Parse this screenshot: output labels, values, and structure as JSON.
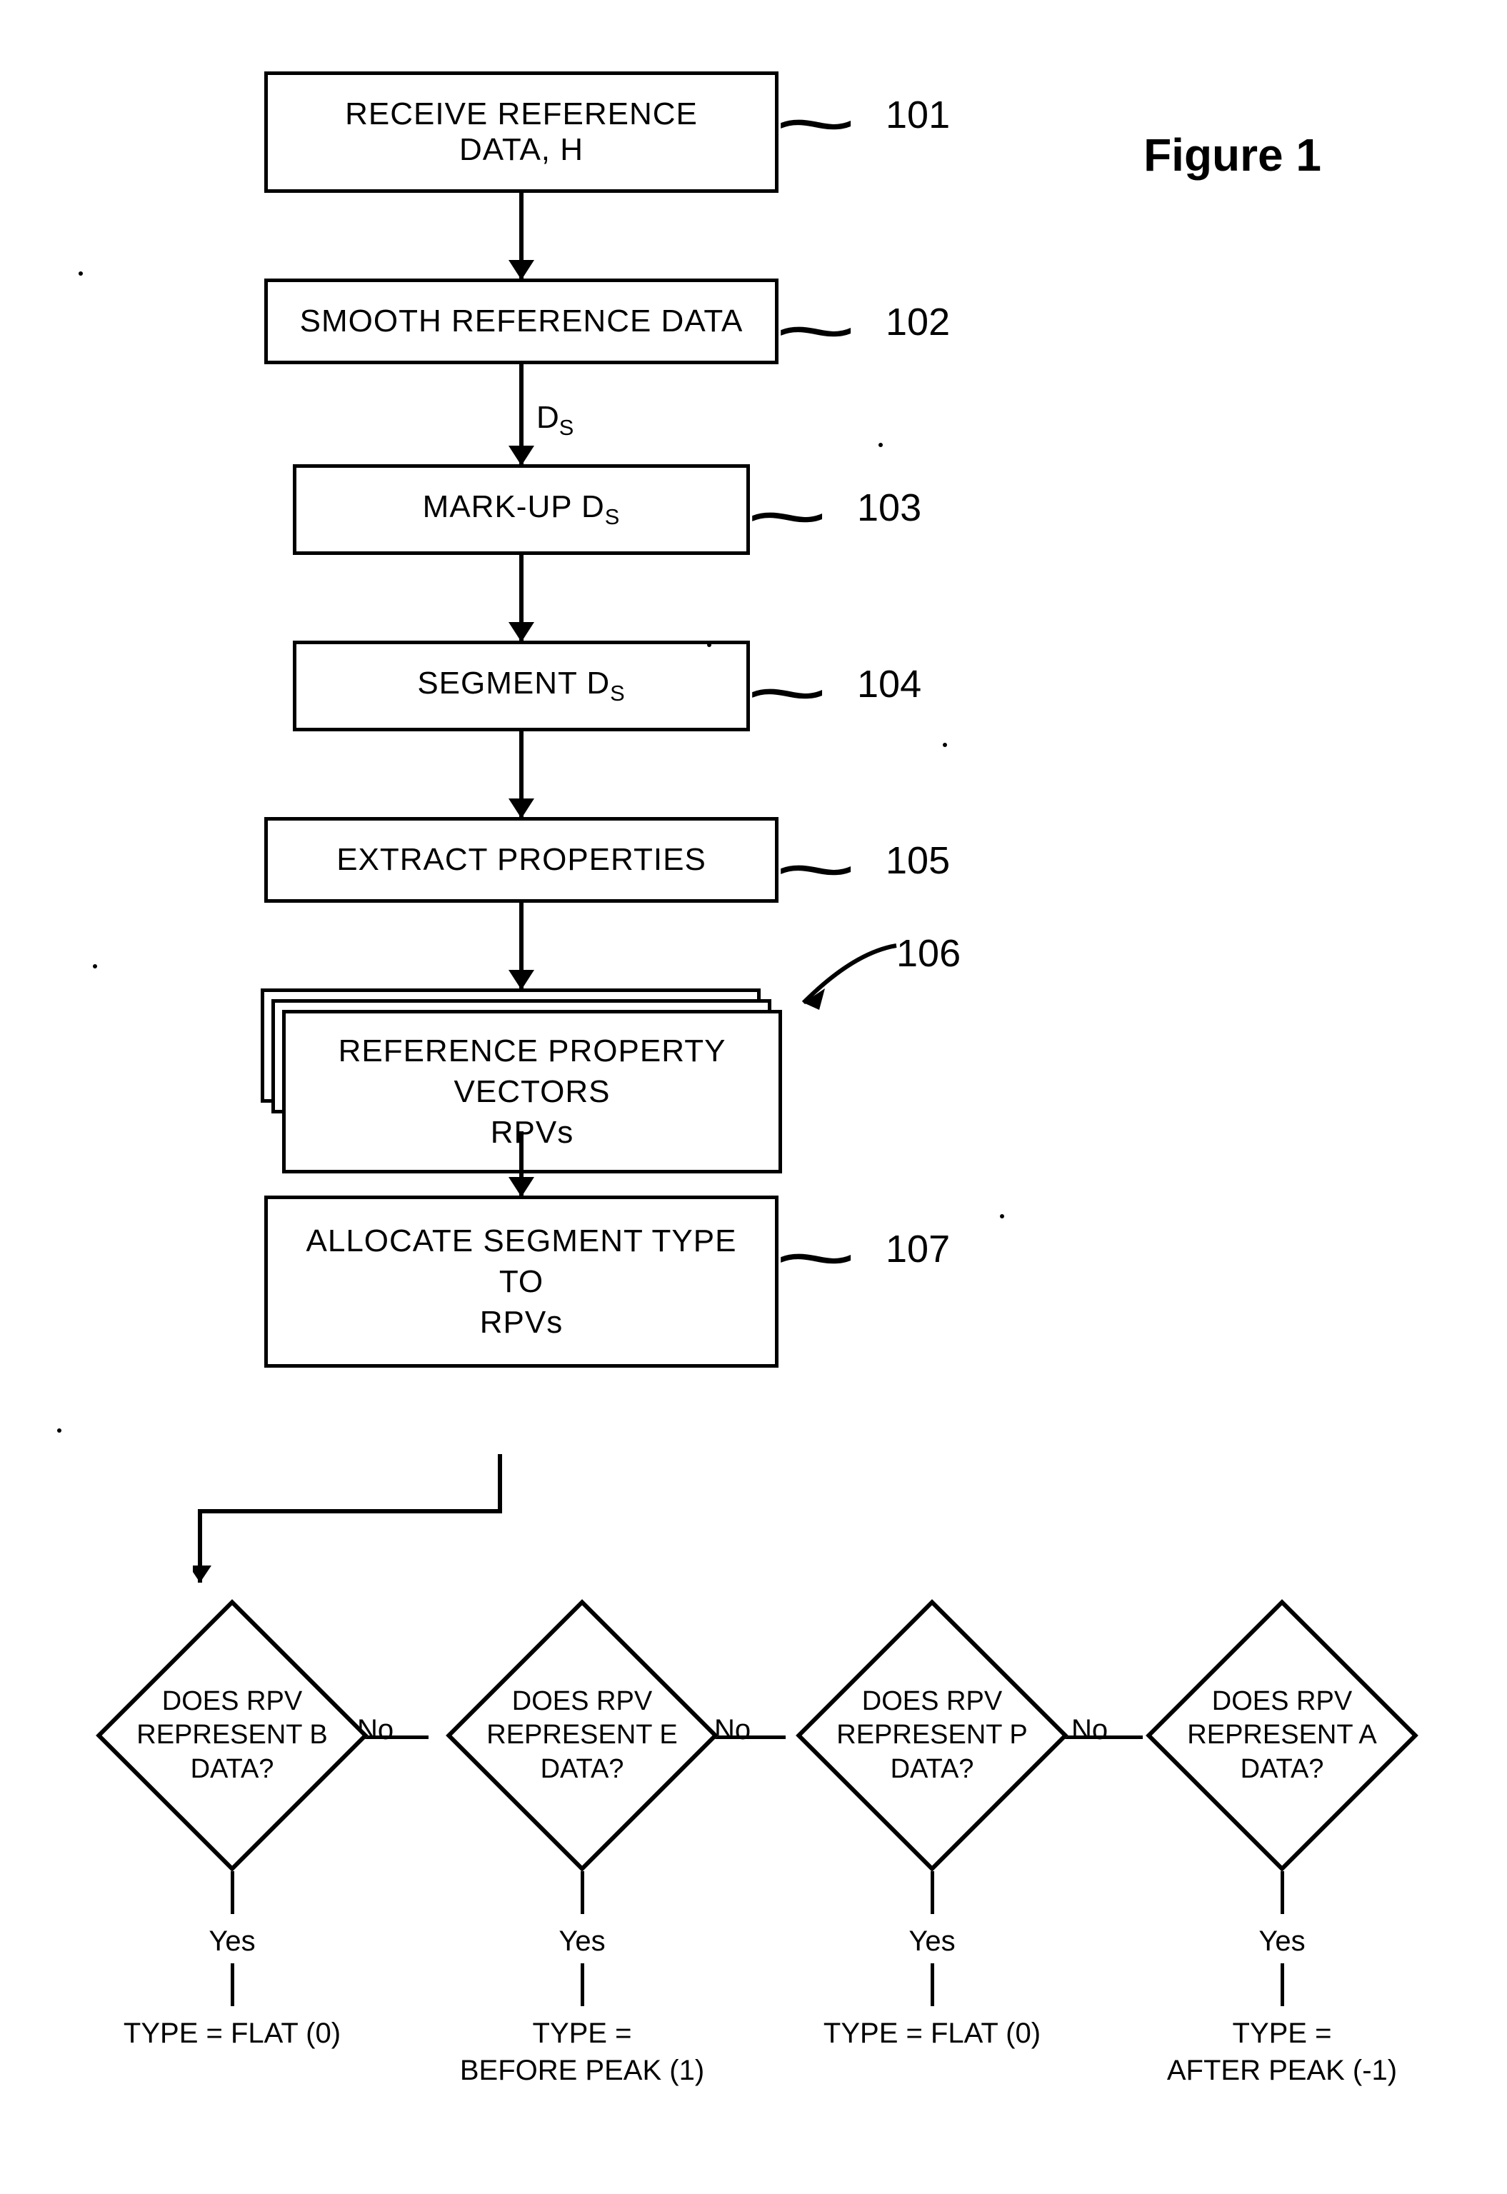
{
  "figure_title": "Figure 1",
  "steps": {
    "s101": {
      "label": "RECEIVE REFERENCE DATA, H",
      "num": "101"
    },
    "s102": {
      "label": "SMOOTH REFERENCE DATA",
      "num": "102"
    },
    "ds_label": "D",
    "ds_sub": "S",
    "s103": {
      "label_pre": "MARK-UP D",
      "label_sub": "S",
      "num": "103"
    },
    "s104": {
      "label_pre": "SEGMENT D",
      "label_sub": "S",
      "num": "104"
    },
    "s105": {
      "label": "EXTRACT PROPERTIES",
      "num": "105"
    },
    "s106": {
      "line1": "REFERENCE PROPERTY VECTORS",
      "line2": "RPVs",
      "num": "106"
    },
    "s107": {
      "line1": "ALLOCATE SEGMENT TYPE TO",
      "line2": "RPVs",
      "num": "107"
    }
  },
  "decisions": [
    {
      "q": "DOES RPV REPRESENT B DATA?",
      "yes": "Yes",
      "type_line1": "TYPE = FLAT (0)",
      "type_line2": ""
    },
    {
      "q": "DOES RPV REPRESENT E DATA?",
      "yes": "Yes",
      "type_line1": "TYPE =",
      "type_line2": "BEFORE PEAK (1)"
    },
    {
      "q": "DOES RPV REPRESENT P DATA?",
      "yes": "Yes",
      "type_line1": "TYPE = FLAT (0)",
      "type_line2": ""
    },
    {
      "q": "DOES RPV REPRESENT A DATA?",
      "yes": "Yes",
      "type_line1": "TYPE =",
      "type_line2": "AFTER PEAK (-1)"
    }
  ],
  "no_label": "No"
}
